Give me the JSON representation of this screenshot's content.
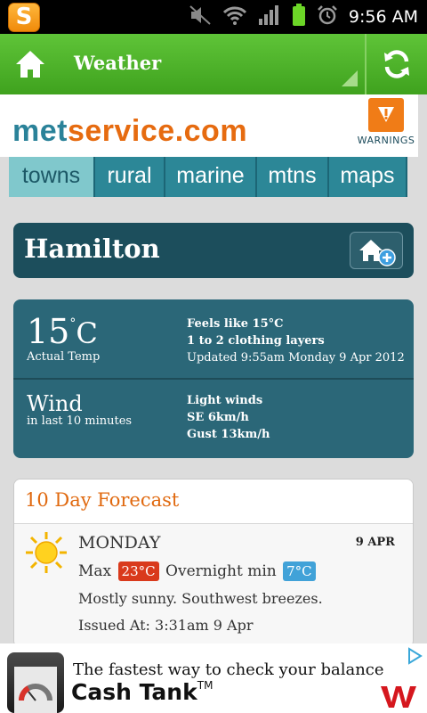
{
  "status_bar": {
    "app_icon_letter": "S",
    "time": "9:56 AM",
    "icons": [
      "mute-icon",
      "wifi-icon",
      "signal-icon",
      "battery-icon",
      "alarm-icon"
    ]
  },
  "action_bar": {
    "title": "Weather",
    "icons": [
      "home-icon",
      "refresh-icon"
    ]
  },
  "banner": {
    "logo_part1": "met",
    "logo_part2": "service.com",
    "warnings_label": "WARNINGS"
  },
  "tabs": [
    {
      "label": "towns",
      "active": true
    },
    {
      "label": "rural",
      "active": false
    },
    {
      "label": "marine",
      "active": false
    },
    {
      "label": "mtns",
      "active": false
    },
    {
      "label": "maps",
      "active": false
    }
  ],
  "location": {
    "name": "Hamilton"
  },
  "conditions": {
    "temp_value": "15",
    "temp_degree": "°",
    "temp_unit": "C",
    "temp_label": "Actual Temp",
    "feels_like": "Feels like 15°C",
    "clothing": "1 to 2 clothing layers",
    "updated": "Updated 9:55am Monday 9 Apr 2012",
    "wind_title": "Wind",
    "wind_label": "in last 10 minutes",
    "wind_desc": "Light winds",
    "wind_dir": "SE 6km/h",
    "wind_gust": "Gust 13km/h"
  },
  "forecast": {
    "title": "10 Day Forecast",
    "days": [
      {
        "day": "MONDAY",
        "date": "9 APR",
        "max_label": "Max",
        "max": "23°C",
        "min_label": "Overnight min",
        "min": "7°C",
        "description": "Mostly sunny. Southwest breezes.",
        "issued": "Issued At: 3:31am 9 Apr",
        "icon": "sun-icon"
      }
    ]
  },
  "ad": {
    "line1": "The fastest way to check your balance",
    "line2": "Cash Tank",
    "tm": "TM"
  },
  "colors": {
    "action_bar_green": "#4cb128",
    "teal_dark": "#1c4e5c",
    "teal": "#2b6778",
    "orange": "#e66b10",
    "max_red": "#d93a1c",
    "min_blue": "#41a2d8"
  }
}
